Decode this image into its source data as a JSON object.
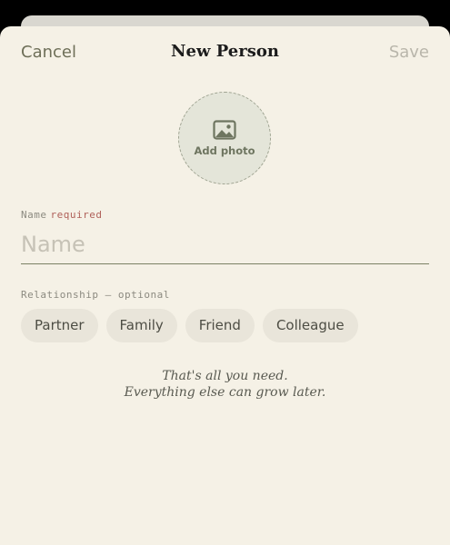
{
  "nav": {
    "cancel_label": "Cancel",
    "title": "New Person",
    "save_label": "Save"
  },
  "photo": {
    "icon": "image-icon",
    "label": "Add photo"
  },
  "name_field": {
    "label": "Name",
    "required_tag": "required",
    "placeholder": "Name",
    "value": ""
  },
  "relationship": {
    "label": "Relationship — optional",
    "options": [
      "Partner",
      "Family",
      "Friend",
      "Colleague"
    ]
  },
  "footer": {
    "line1": "That's all you need.",
    "line2": "Everything else can grow later."
  },
  "colors": {
    "background": "#f5f1e6",
    "accent": "#6e7560",
    "required": "#b0615a",
    "chip": "#e9e5da"
  }
}
